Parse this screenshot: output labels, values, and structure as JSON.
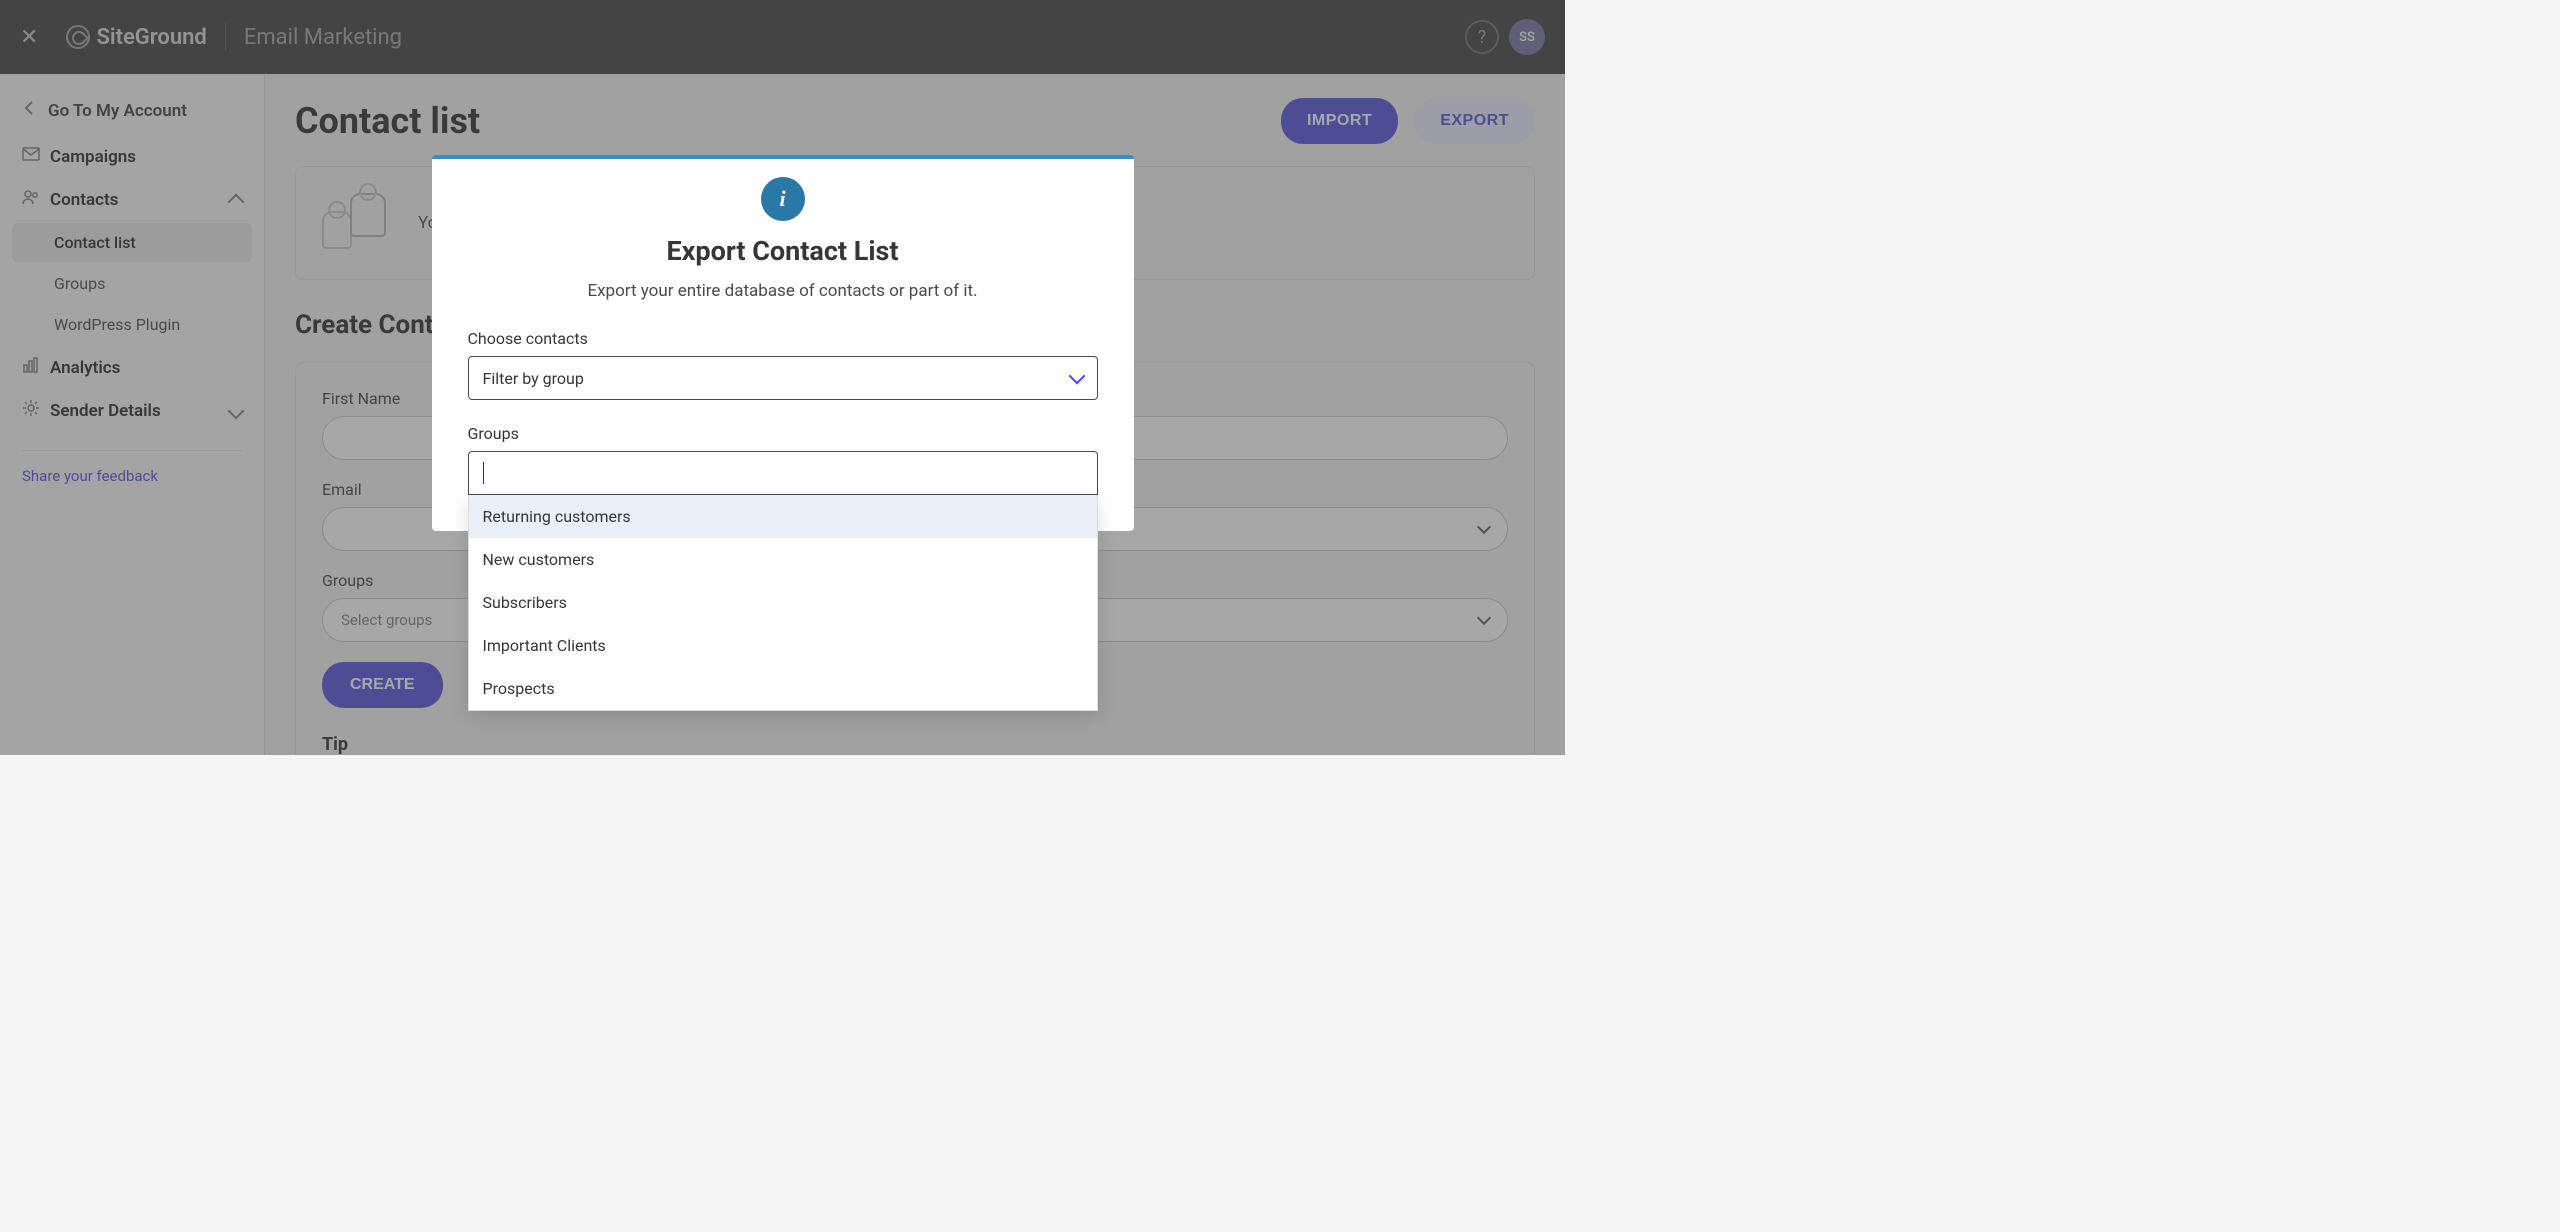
{
  "header": {
    "brand": "SiteGround",
    "app_name": "Email Marketing",
    "avatar_initials": "SS"
  },
  "sidebar": {
    "back_label": "Go To My Account",
    "items": [
      {
        "label": "Campaigns",
        "expandable": false
      },
      {
        "label": "Contacts",
        "expandable": true,
        "expanded": true
      },
      {
        "label": "Analytics",
        "expandable": false
      },
      {
        "label": "Sender Details",
        "expandable": true,
        "expanded": false
      }
    ],
    "contacts_children": [
      {
        "label": "Contact list",
        "active": true
      },
      {
        "label": "Groups",
        "active": false
      },
      {
        "label": "WordPress Plugin",
        "active": false
      }
    ],
    "share_label": "Share your feedback"
  },
  "page": {
    "title": "Contact list",
    "import_btn": "IMPORT",
    "export_btn": "EXPORT",
    "info_text": "You can assign different groups to your contacts and change their subscription status.",
    "create_heading": "Create Contact",
    "fields": {
      "first_name": "First Name",
      "email": "Email",
      "groups": "Groups",
      "groups_placeholder": "Select groups"
    },
    "create_btn": "CREATE",
    "tip_heading": "Tip"
  },
  "modal": {
    "title": "Export Contact List",
    "subtitle": "Export your entire database of contacts or part of it.",
    "choose_label": "Choose contacts",
    "choose_value": "Filter by group",
    "groups_label": "Groups",
    "group_options": [
      "Returning customers",
      "New customers",
      "Subscribers",
      "Important Clients",
      "Prospects"
    ]
  }
}
